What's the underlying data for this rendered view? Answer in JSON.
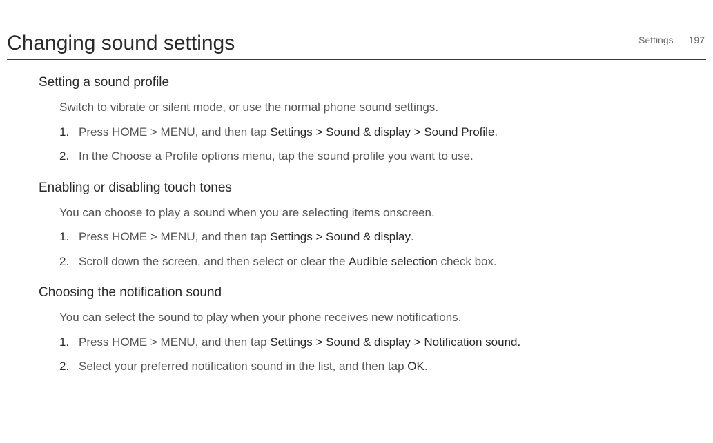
{
  "header": {
    "section_label": "Settings",
    "page_number": "197"
  },
  "title": "Changing sound settings",
  "sections": [
    {
      "heading": "Setting a sound profile",
      "intro": "Switch to vibrate or silent mode, or use the normal phone sound settings.",
      "steps": [
        {
          "pre": "Press HOME > MENU, and then tap ",
          "bold": "Settings > Sound & display > Sound Profile",
          "post": "."
        },
        {
          "pre": "In the Choose a Profile options menu, tap the sound profile you want to use.",
          "bold": "",
          "post": ""
        }
      ]
    },
    {
      "heading": "Enabling or disabling touch tones",
      "intro": "You can choose to play a sound when you are selecting items onscreen.",
      "steps": [
        {
          "pre": "Press HOME > MENU, and then tap ",
          "bold": "Settings > Sound & display",
          "post": "."
        },
        {
          "pre": "Scroll down the screen, and then select or clear the ",
          "bold": "Audible selection",
          "post": " check box."
        }
      ]
    },
    {
      "heading": "Choosing the notification sound",
      "intro": "You can select the sound to play when your phone receives new notifications.",
      "steps": [
        {
          "pre": "Press HOME > MENU, and then tap ",
          "bold": "Settings > Sound & display > Notification sound.",
          "post": ""
        },
        {
          "pre": "Select your preferred notification sound in the list, and then tap ",
          "bold": "OK",
          "post": "."
        }
      ]
    }
  ]
}
